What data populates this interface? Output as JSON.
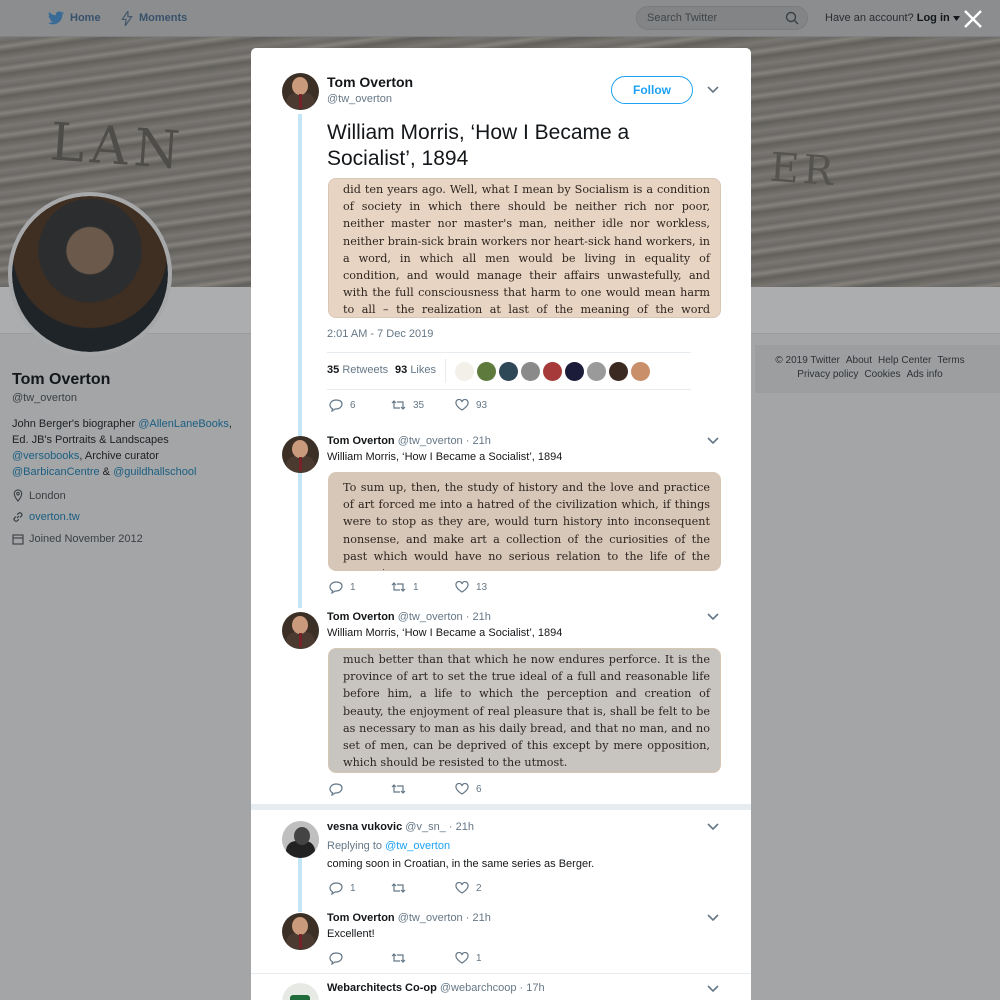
{
  "nav": {
    "home": "Home",
    "moments": "Moments",
    "search_placeholder": "Search Twitter",
    "have_account": "Have an account?",
    "login": "Log in"
  },
  "profile": {
    "name": "Tom Overton",
    "handle": "@tw_overton",
    "bio": {
      "p1": "John Berger's biographer ",
      "l1": "@AllenLaneBooks",
      "p2": ", Ed. JB's Portraits & Landscapes ",
      "l2": "@versobooks",
      "p3": ", Archive curator ",
      "l3": "@BarbicanCentre",
      "p4": " & ",
      "l4": "@guildhallschool"
    },
    "location": "London",
    "website": "overton.tw",
    "joined": "Joined November 2012"
  },
  "footer": {
    "copyright": "© 2019 Twitter",
    "about": "About",
    "help": "Help Center",
    "terms": "Terms",
    "privacy": "Privacy policy",
    "cookies": "Cookies",
    "ads": "Ads info"
  },
  "main_tweet": {
    "name": "Tom Overton",
    "handle": "@tw_overton",
    "follow": "Follow",
    "text": "William Morris, ‘How I Became a Socialist’, 1894",
    "image_text": "did ten years ago. Well, what I mean by Socialism is a condition of society in which there should be neither rich nor poor, neither master nor master's man, neither idle nor workless, neither brain-sick brain workers nor heart-sick hand workers, in a word, in which all men would be living in equality of condition, and would manage their affairs unwastefully, and with the full consciousness that harm to one would mean harm to all – the realization at last of the meaning of the word COMMONWEALTH.",
    "timestamp": "2:01 AM - 7 Dec 2019",
    "retweets_count": "35",
    "retweets_label": "Retweets",
    "likes_count": "93",
    "likes_label": "Likes",
    "replies": "6",
    "retweets": "35",
    "likes": "93"
  },
  "tweets": [
    {
      "name": "Tom Overton",
      "handle": "@tw_overton",
      "time": "· 21h",
      "text": "William Morris, ‘How I Became a Socialist’, 1894",
      "image_text": "To sum up, then, the study of history and the love and practice of art forced me into a hatred of the civilization which, if things were to stop as they are, would turn history into inconsequent nonsense, and make art a collection of the curiosities of the past which would have no serious relation to the life of the present.",
      "replies": "1",
      "retweets": "1",
      "likes": "13"
    },
    {
      "name": "Tom Overton",
      "handle": "@tw_overton",
      "time": "· 21h",
      "text": "William Morris, ‘How I Became a Socialist’, 1894",
      "image_text": "much better than that which he now endures perforce. It is the province of art to set the true ideal of a full and reasonable life before him, a life to which the perception and creation of beauty, the enjoyment of real pleasure that is, shall be felt to be as necessary to man as his daily bread, and that no man, and no set of men, can be deprived of this except by mere opposition, which should be resisted to the utmost.",
      "replies": "",
      "retweets": "",
      "likes": "6"
    }
  ],
  "replies": [
    {
      "name": "vesna vukovic",
      "handle": "@v_sn_",
      "time": "· 21h",
      "replying_label": "Replying to",
      "replying_to": "@tw_overton",
      "text": "coming soon in Croatian, in the same series as Berger.",
      "replies": "1",
      "retweets": "",
      "likes": "2"
    },
    {
      "name": "Tom Overton",
      "handle": "@tw_overton",
      "time": "· 21h",
      "text": "Excellent!",
      "replies": "",
      "retweets": "",
      "likes": "1"
    },
    {
      "name": "Webarchitects Co-op",
      "handle": "@webarchcoop",
      "time": "· 17h"
    }
  ],
  "colors": {
    "accent": "#1da1f2",
    "thread_line": "#c4e5f6",
    "overlay": "#a3a5a7"
  }
}
